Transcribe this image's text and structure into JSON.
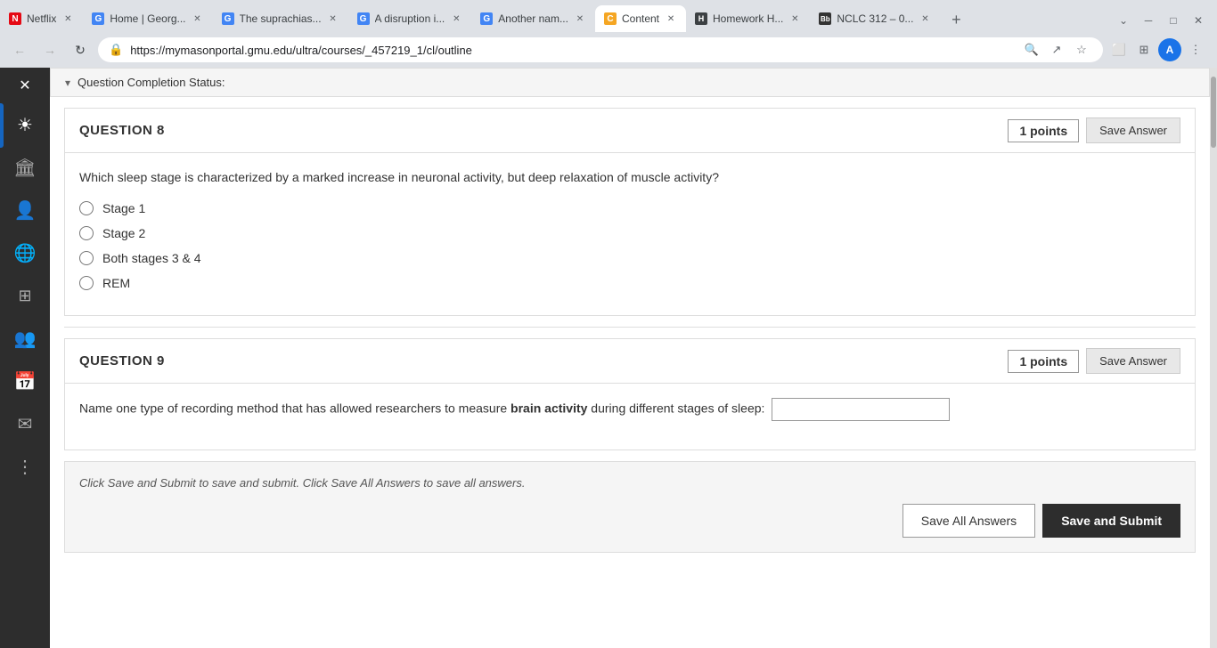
{
  "browser": {
    "url": "https://mymasonportal.gmu.edu/ultra/courses/_457219_1/cl/outline",
    "tabs": [
      {
        "id": "netflix",
        "label": "Netflix",
        "favicon_color": "#e50914",
        "favicon_text": "N",
        "active": false
      },
      {
        "id": "home-georg",
        "label": "Home | Georg...",
        "favicon_color": "#4285f4",
        "favicon_text": "G",
        "active": false
      },
      {
        "id": "suprachias",
        "label": "The suprachias...",
        "favicon_color": "#4285f4",
        "favicon_text": "G",
        "active": false
      },
      {
        "id": "disruption",
        "label": "A disruption i...",
        "favicon_color": "#4285f4",
        "favicon_text": "G",
        "active": false
      },
      {
        "id": "another-nam",
        "label": "Another nam...",
        "favicon_color": "#4285f4",
        "favicon_text": "G",
        "active": false
      },
      {
        "id": "content",
        "label": "Content",
        "favicon_color": "#f5a623",
        "favicon_text": "C",
        "active": true
      },
      {
        "id": "homework",
        "label": "Homework H...",
        "favicon_color": "#3c4043",
        "favicon_text": "H",
        "active": false
      },
      {
        "id": "nclc312",
        "label": "NCLC 312 – 0...",
        "favicon_color": "#333",
        "favicon_text": "Bb",
        "active": false
      }
    ],
    "profile_initial": "A",
    "menu_dots": "⋮"
  },
  "sidebar": {
    "icons": [
      {
        "name": "close",
        "symbol": "✕"
      },
      {
        "name": "home",
        "symbol": "🏛"
      },
      {
        "name": "profile",
        "symbol": "👤"
      },
      {
        "name": "globe",
        "symbol": "🌐"
      },
      {
        "name": "grid",
        "symbol": "⊞"
      },
      {
        "name": "groups",
        "symbol": "👥"
      },
      {
        "name": "calendar",
        "symbol": "📅"
      },
      {
        "name": "mail",
        "symbol": "✉"
      },
      {
        "name": "dots",
        "symbol": "⋮"
      }
    ]
  },
  "quiz": {
    "completion_status_label": "Question Completion Status:",
    "questions": [
      {
        "id": "q8",
        "title": "QUESTION 8",
        "points": "1 points",
        "save_label": "Save Answer",
        "text_before": "Which sleep stage is characterized by a marked increase in neuronal activity, but deep relaxation of muscle activity?",
        "options": [
          {
            "id": "q8_1",
            "label": "Stage 1"
          },
          {
            "id": "q8_2",
            "label": "Stage 2"
          },
          {
            "id": "q8_3",
            "label": "Both stages 3 & 4"
          },
          {
            "id": "q8_4",
            "label": "REM"
          }
        ],
        "type": "radio"
      },
      {
        "id": "q9",
        "title": "QUESTION 9",
        "points": "1 points",
        "save_label": "Save Answer",
        "text_part1": "Name one type of recording method that has allowed researchers to measure ",
        "text_bold": "brain activity",
        "text_part2": " during different stages of sleep:",
        "type": "fill-in"
      }
    ],
    "footer": {
      "instruction": "Click Save and Submit to save and submit. Click Save All Answers to save all answers.",
      "save_all_label": "Save All Answers",
      "submit_label": "Save and Submit"
    }
  }
}
